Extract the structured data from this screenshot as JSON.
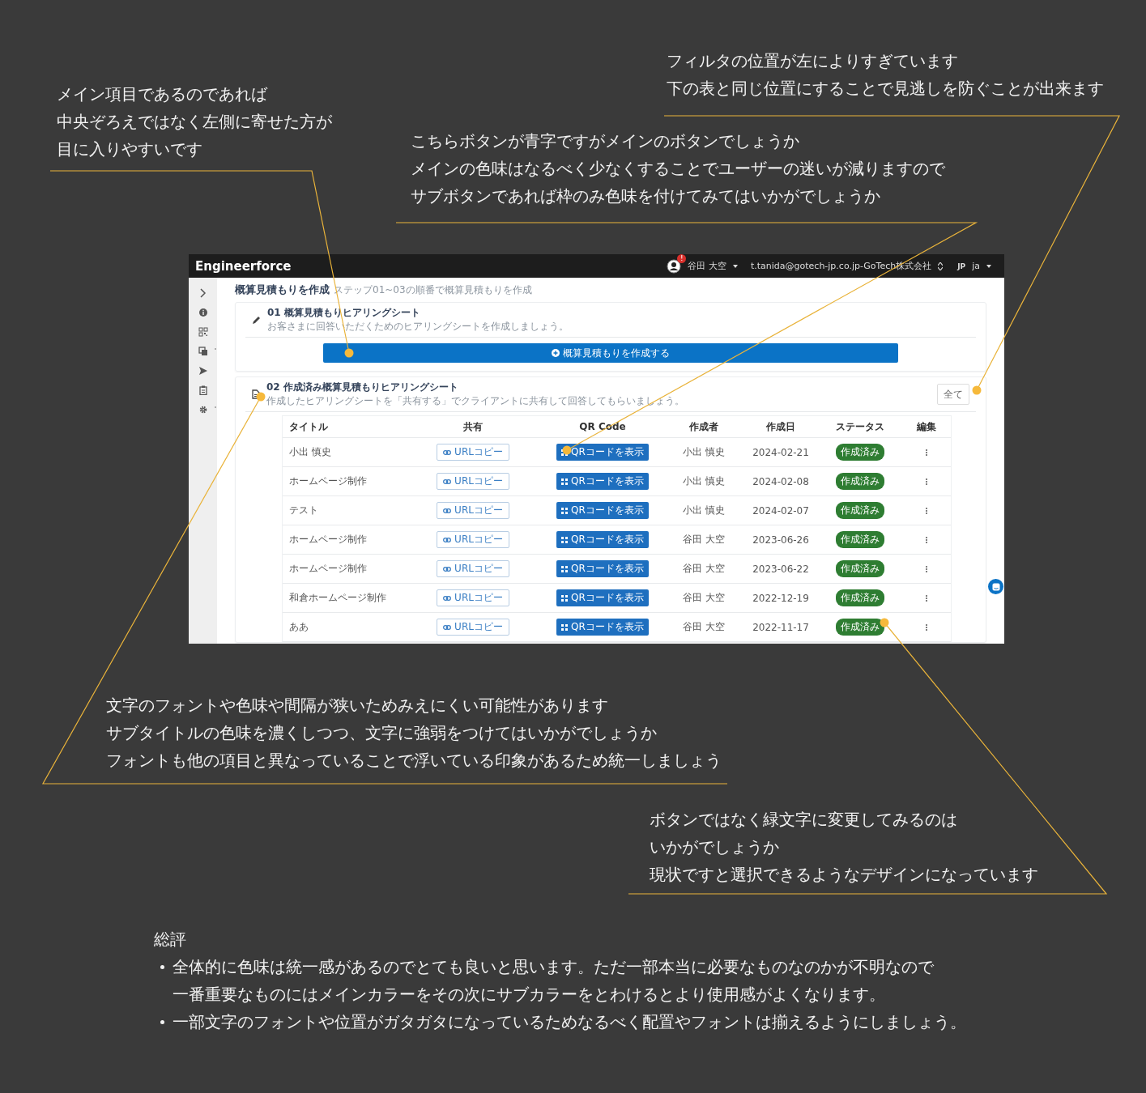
{
  "annotations": [
    {
      "lines": [
        "メイン項目であるのであれば",
        "中央ぞろえではなく左側に寄せた方が",
        "目に入りやすいです"
      ]
    },
    {
      "lines": [
        "フィルタの位置が左によりすぎています",
        "下の表と同じ位置にすることで見逃しを防ぐことが出来ます"
      ]
    },
    {
      "lines": [
        "こちらボタンが青字ですがメインのボタンでしょうか",
        "メインの色味はなるべく少なくすることでユーザーの迷いが減りますので",
        "サブボタンであれば枠のみ色味を付けてみてはいかがでしょうか"
      ]
    },
    {
      "lines": [
        "文字のフォントや色味や間隔が狭いためみえにくい可能性があります",
        "サブタイトルの色味を濃くしつつ、文字に強弱をつけてはいかがでしょうか",
        "フォントも他の項目と異なっていることで浮いている印象があるため統一しましょう"
      ]
    },
    {
      "lines": [
        "ボタンではなく緑文字に変更してみるのは",
        "いかがでしょうか",
        "現状ですと選択できるようなデザインになっています"
      ]
    }
  ],
  "app": {
    "header": {
      "logo": "Engineerforce",
      "notification_badge": "!",
      "user_name": "谷田 大空",
      "account": "t.tanida@gotech-jp.co.jp-GoTech株式会社",
      "flag": "JP",
      "language": "ja"
    },
    "page_title": "概算見積もりを作成",
    "page_subtitle": "ステップ01~03の順番で概算見積もりを作成",
    "step1": {
      "title": "01 概算見積もりヒアリングシート",
      "description": "お客さまに回答いただくためのヒアリングシートを作成しましょう。",
      "button": "概算見積もりを作成する"
    },
    "step2": {
      "title": "02 作成済み概算見積もりヒアリングシート",
      "description": "作成したヒアリングシートを「共有する」でクライアントに共有して回答してもらいましょう。",
      "filter": "全て"
    },
    "table": {
      "columns": [
        "タイトル",
        "共有",
        "QR Code",
        "作成者",
        "作成日",
        "ステータス",
        "編集"
      ],
      "rows": [
        {
          "title": "小出 慎史",
          "share": "URLコピー",
          "qr": "QRコードを表示",
          "author": "小出 慎史",
          "date": "2024-02-21",
          "status": "作成済み"
        },
        {
          "title": "ホームページ制作",
          "share": "URLコピー",
          "qr": "QRコードを表示",
          "author": "小出 慎史",
          "date": "2024-02-08",
          "status": "作成済み"
        },
        {
          "title": "テスト",
          "share": "URLコピー",
          "qr": "QRコードを表示",
          "author": "小出 慎史",
          "date": "2024-02-07",
          "status": "作成済み"
        },
        {
          "title": "ホームページ制作",
          "share": "URLコピー",
          "qr": "QRコードを表示",
          "author": "谷田 大空",
          "date": "2023-06-26",
          "status": "作成済み"
        },
        {
          "title": "ホームページ制作",
          "share": "URLコピー",
          "qr": "QRコードを表示",
          "author": "谷田 大空",
          "date": "2023-06-22",
          "status": "作成済み"
        },
        {
          "title": "和倉ホームページ制作",
          "share": "URLコピー",
          "qr": "QRコードを表示",
          "author": "谷田 大空",
          "date": "2022-12-19",
          "status": "作成済み"
        },
        {
          "title": "ああ",
          "share": "URLコピー",
          "qr": "QRコードを表示",
          "author": "谷田 大空",
          "date": "2022-11-17",
          "status": "作成済み"
        }
      ]
    }
  },
  "summary": {
    "heading": "総評",
    "items": [
      {
        "lines": [
          "全体的に色味は統一感があるのでとても良いと思います。ただ一部本当に必要なものなのかが不明なので",
          "一番重要なものにはメインカラーをその次にサブカラーをとわけるとより使用感がよくなります。"
        ]
      },
      {
        "lines": [
          "一部文字のフォントや位置がガタガタになっているためなるべく配置やフォントは揃えるようにしましょう。"
        ]
      }
    ]
  }
}
